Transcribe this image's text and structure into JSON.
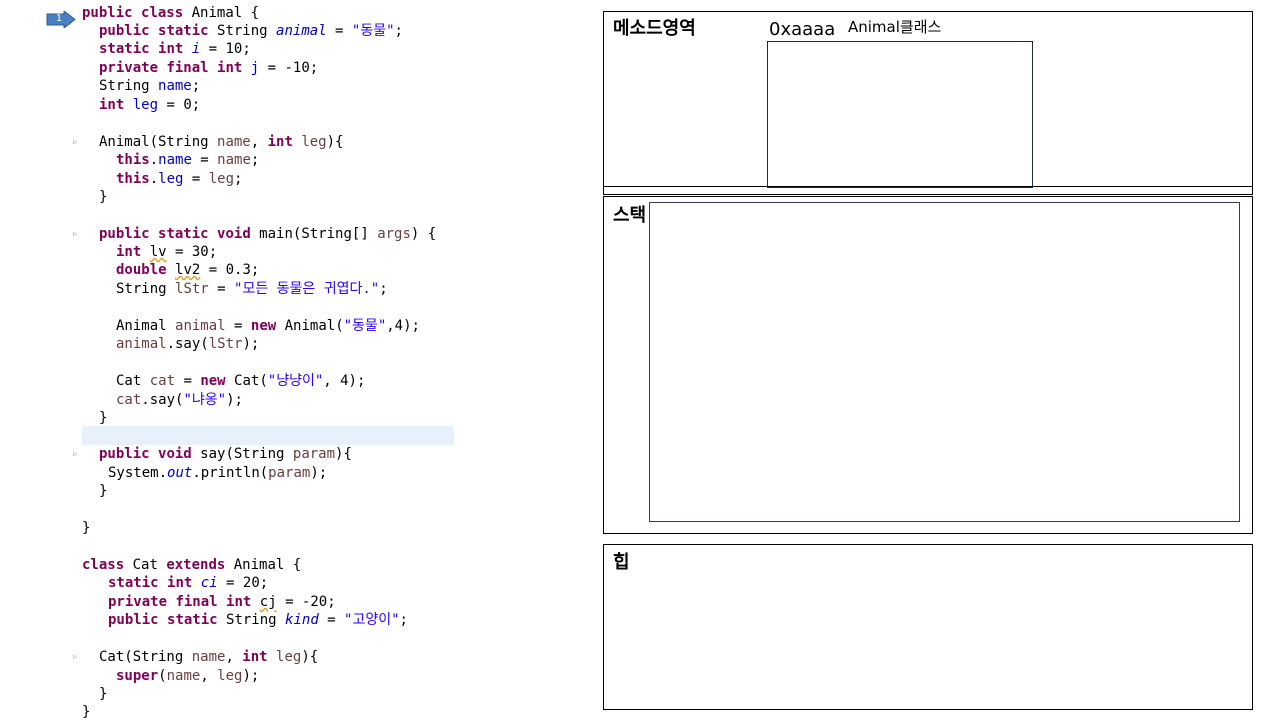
{
  "code": {
    "marker": "1",
    "lines": [
      [
        [
          "kw",
          "public"
        ],
        [
          "t",
          " "
        ],
        [
          "kw",
          "class"
        ],
        [
          "t",
          " Animal {"
        ]
      ],
      [
        [
          "kw",
          "public"
        ],
        [
          "t",
          " "
        ],
        [
          "kw",
          "static"
        ],
        [
          "t",
          " String "
        ],
        [
          "sfld",
          "animal"
        ],
        [
          "t",
          " = "
        ],
        [
          "str",
          "\"동물\""
        ],
        [
          "t",
          ";"
        ]
      ],
      [
        [
          "kw",
          "static"
        ],
        [
          "t",
          " "
        ],
        [
          "kw",
          "int"
        ],
        [
          "t",
          " "
        ],
        [
          "sfld",
          "i"
        ],
        [
          "t",
          " = 10;"
        ]
      ],
      [
        [
          "kw",
          "private"
        ],
        [
          "t",
          " "
        ],
        [
          "kw",
          "final"
        ],
        [
          "t",
          " "
        ],
        [
          "kw",
          "int"
        ],
        [
          "t",
          " "
        ],
        [
          "fld",
          "j"
        ],
        [
          "t",
          " = -10;"
        ]
      ],
      [
        [
          "t",
          "String "
        ],
        [
          "fld",
          "name"
        ],
        [
          "t",
          ";"
        ]
      ],
      [
        [
          "kw",
          "int"
        ],
        [
          "t",
          " "
        ],
        [
          "fld",
          "leg"
        ],
        [
          "t",
          " = 0;"
        ]
      ],
      [
        [
          "t",
          "Animal(String "
        ],
        [
          "prm",
          "name"
        ],
        [
          "t",
          ", "
        ],
        [
          "kw",
          "int"
        ],
        [
          "t",
          " "
        ],
        [
          "prm",
          "leg"
        ],
        [
          "t",
          "){"
        ]
      ],
      [
        [
          "kw",
          "this"
        ],
        [
          "t",
          "."
        ],
        [
          "fld",
          "name"
        ],
        [
          "t",
          " = "
        ],
        [
          "prm",
          "name"
        ],
        [
          "t",
          ";"
        ]
      ],
      [
        [
          "kw",
          "this"
        ],
        [
          "t",
          "."
        ],
        [
          "fld",
          "leg"
        ],
        [
          "t",
          " = "
        ],
        [
          "prm",
          "leg"
        ],
        [
          "t",
          ";"
        ]
      ],
      [
        [
          "t",
          "}"
        ]
      ],
      [
        [
          "kw",
          "public"
        ],
        [
          "t",
          " "
        ],
        [
          "kw",
          "static"
        ],
        [
          "t",
          " "
        ],
        [
          "kw",
          "void"
        ],
        [
          "t",
          " main(String[] "
        ],
        [
          "prm",
          "args"
        ],
        [
          "t",
          ") {"
        ]
      ],
      [
        [
          "kw",
          "int"
        ],
        [
          "t",
          " "
        ],
        [
          "warn",
          "lv"
        ],
        [
          "t",
          " = 30;"
        ]
      ],
      [
        [
          "kw",
          "double"
        ],
        [
          "t",
          " "
        ],
        [
          "warn",
          "lv2"
        ],
        [
          "t",
          " = 0.3;"
        ]
      ],
      [
        [
          "t",
          "String "
        ],
        [
          "loc",
          "lStr"
        ],
        [
          "t",
          " = "
        ],
        [
          "str",
          "\"모든 동물은 귀엽다.\""
        ],
        [
          "t",
          ";"
        ]
      ],
      [
        [
          "t",
          "Animal "
        ],
        [
          "loc",
          "animal"
        ],
        [
          "t",
          " = "
        ],
        [
          "kw",
          "new"
        ],
        [
          "t",
          " Animal("
        ],
        [
          "str",
          "\"동물\""
        ],
        [
          "t",
          ",4);"
        ]
      ],
      [
        [
          "loc",
          "animal"
        ],
        [
          "t",
          ".say("
        ],
        [
          "loc",
          "lStr"
        ],
        [
          "t",
          ");"
        ]
      ],
      [
        [
          "t",
          "Cat "
        ],
        [
          "loc",
          "cat"
        ],
        [
          "t",
          " = "
        ],
        [
          "kw",
          "new"
        ],
        [
          "t",
          " Cat("
        ],
        [
          "str",
          "\"냥냥이\""
        ],
        [
          "t",
          ", 4);"
        ]
      ],
      [
        [
          "loc",
          "cat"
        ],
        [
          "t",
          ".say("
        ],
        [
          "str",
          "\"냐옹\""
        ],
        [
          "t",
          ");"
        ]
      ],
      [
        [
          "t",
          "}"
        ]
      ],
      [
        [
          "kw",
          "public"
        ],
        [
          "t",
          " "
        ],
        [
          "kw",
          "void"
        ],
        [
          "t",
          " say(String "
        ],
        [
          "prm",
          "param"
        ],
        [
          "t",
          "){"
        ]
      ],
      [
        [
          "t",
          "System."
        ],
        [
          "sfld",
          "out"
        ],
        [
          "t",
          ".println("
        ],
        [
          "prm",
          "param"
        ],
        [
          "t",
          ");"
        ]
      ],
      [
        [
          "t",
          "}"
        ]
      ],
      [
        [
          "t",
          "}"
        ]
      ],
      [
        [
          "kw",
          "class"
        ],
        [
          "t",
          " Cat "
        ],
        [
          "kw",
          "extends"
        ],
        [
          "t",
          " Animal {"
        ]
      ],
      [
        [
          "kw",
          "static"
        ],
        [
          "t",
          " "
        ],
        [
          "kw",
          "int"
        ],
        [
          "t",
          " "
        ],
        [
          "sfld",
          "ci"
        ],
        [
          "t",
          " = 20;"
        ]
      ],
      [
        [
          "kw",
          "private"
        ],
        [
          "t",
          " "
        ],
        [
          "kw",
          "final"
        ],
        [
          "t",
          " "
        ],
        [
          "kw",
          "int"
        ],
        [
          "t",
          " "
        ],
        [
          "warn",
          "cj"
        ],
        [
          "t",
          " = -20;"
        ]
      ],
      [
        [
          "kw",
          "public"
        ],
        [
          "t",
          " "
        ],
        [
          "kw",
          "static"
        ],
        [
          "t",
          " String "
        ],
        [
          "sfld",
          "kind"
        ],
        [
          "t",
          " = "
        ],
        [
          "str",
          "\"고양이\""
        ],
        [
          "t",
          ";"
        ]
      ],
      [
        [
          "t",
          "Cat(String "
        ],
        [
          "prm",
          "name"
        ],
        [
          "t",
          ", "
        ],
        [
          "kw",
          "int"
        ],
        [
          "t",
          " "
        ],
        [
          "prm",
          "leg"
        ],
        [
          "t",
          "){"
        ]
      ],
      [
        [
          "kw",
          "super"
        ],
        [
          "t",
          "("
        ],
        [
          "prm",
          "name"
        ],
        [
          "t",
          ", "
        ],
        [
          "prm",
          "leg"
        ],
        [
          "t",
          ");"
        ]
      ],
      [
        [
          "t",
          "}"
        ]
      ],
      [
        [
          "t",
          "}"
        ]
      ]
    ]
  },
  "memory": {
    "method_area": {
      "title": "메소드영역",
      "address": "0xaaaa",
      "class_label": "Animal클래스"
    },
    "stack": {
      "title": "스택"
    },
    "heap": {
      "title": "힙"
    }
  }
}
